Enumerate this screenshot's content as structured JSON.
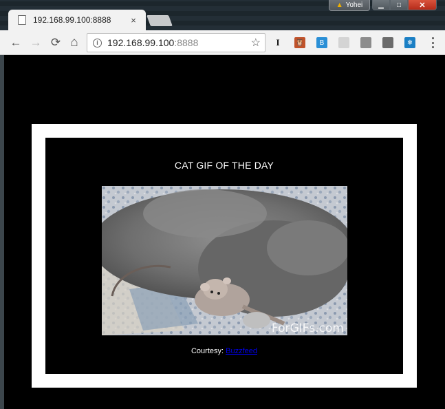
{
  "browser": {
    "tab_title": "192.168.99.100:8888",
    "tab_close": "×",
    "profile_name": "Yohei",
    "address": {
      "host": "192.168.99.100",
      "port": ":8888"
    },
    "nav": {
      "back": "←",
      "forward": "→",
      "reload": "⟳",
      "home": "⌂"
    },
    "star": "☆",
    "window_controls": {
      "minimize": "▁",
      "maximize": "□",
      "close": "✕"
    },
    "extensions": [
      {
        "name": "instapaper-icon",
        "glyph": "I",
        "color": "#f2f2f2"
      },
      {
        "name": "owl-extension-icon",
        "glyph": "🦉",
        "color": "#c0532b"
      },
      {
        "name": "blue-extension-icon",
        "glyph": "B",
        "color": "#2a8fd6"
      },
      {
        "name": "gray-extension-icon",
        "glyph": "",
        "color": "#d4d4d4"
      },
      {
        "name": "chat-extension-icon",
        "glyph": "",
        "color": "#8c8c8c"
      },
      {
        "name": "pocket-extension-icon",
        "glyph": "",
        "color": "#6b6b6b"
      },
      {
        "name": "snowflake-extension-icon",
        "glyph": "❄",
        "color": "#1a7fc4"
      }
    ]
  },
  "page": {
    "heading": "CAT GIF OF THE DAY",
    "watermark": "ForGIFs.com",
    "courtesy_label": "Courtesy:",
    "courtesy_link": "Buzzfeed"
  }
}
